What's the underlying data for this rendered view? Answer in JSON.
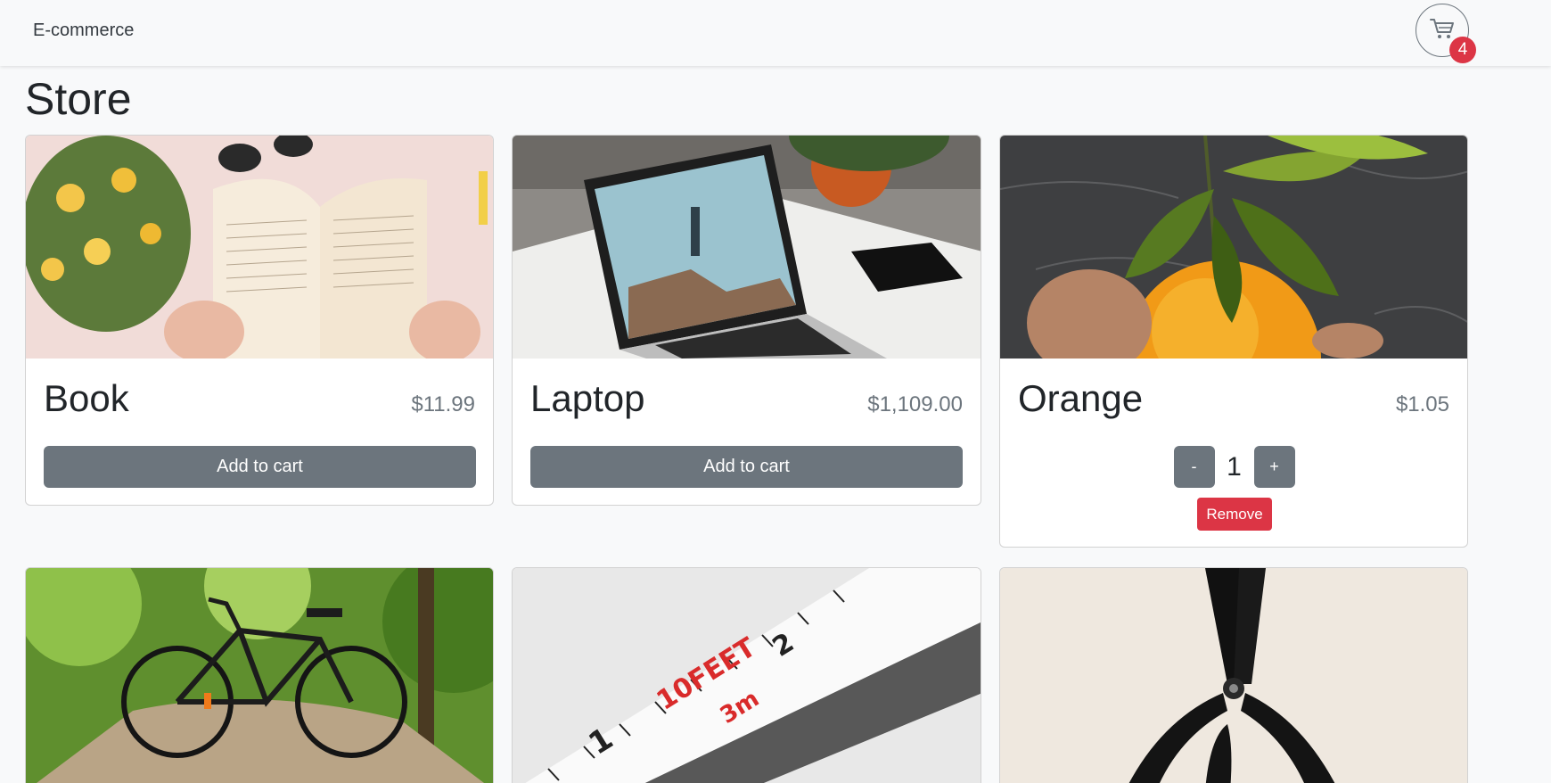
{
  "navbar": {
    "brand": "E-commerce",
    "cart_count": "4"
  },
  "page": {
    "title": "Store"
  },
  "products": [
    {
      "name": "Book",
      "price": "$11.99",
      "action": "Add to cart"
    },
    {
      "name": "Laptop",
      "price": "$1,109.00",
      "action": "Add to cart"
    },
    {
      "name": "Orange",
      "price": "$1.05",
      "quantity": "1",
      "decrement": "-",
      "increment": "+",
      "remove": "Remove"
    },
    {
      "name": "Bicycle"
    },
    {
      "name": "Tape measure"
    },
    {
      "name": "Scissors"
    }
  ],
  "icons": {
    "cart": "cart-icon"
  },
  "colors": {
    "secondary": "#6c757d",
    "danger": "#dc3545",
    "background": "#f8f9fa"
  }
}
